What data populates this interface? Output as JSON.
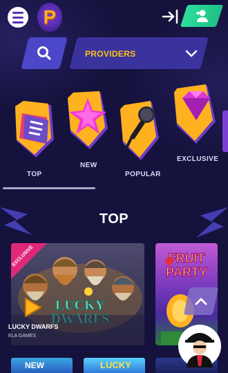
{
  "header": {
    "logo_letter": "P"
  },
  "search": {
    "providers_label": "PROVIDERS"
  },
  "categories": [
    {
      "label": "TOP",
      "icon": "document-shield-icon"
    },
    {
      "label": "NEW",
      "icon": "star-shield-icon"
    },
    {
      "label": "POPULAR",
      "icon": "microphone-shield-icon"
    },
    {
      "label": "EXCLUSIVE",
      "icon": "diamond-shield-icon"
    }
  ],
  "section": {
    "title": "TOP"
  },
  "games": [
    {
      "name": "LUCKY DWARFS",
      "provider": "ELA GAMES",
      "badge": "EXCLUSIVE",
      "art_title_1": "LUCKY",
      "art_title_2": "DWARFS"
    },
    {
      "art_title_1": "FRUIT",
      "art_title_2": "PARTY"
    }
  ],
  "bottom_cards": [
    {
      "art_text": "NEW"
    },
    {
      "art_text": "LUCKY"
    },
    {
      "art_text": ""
    }
  ],
  "colors": {
    "background": "#15123d",
    "accent_gold": "#ffc21a",
    "accent_green": "#2ddf9c",
    "panel_blue": "#3a339e"
  }
}
